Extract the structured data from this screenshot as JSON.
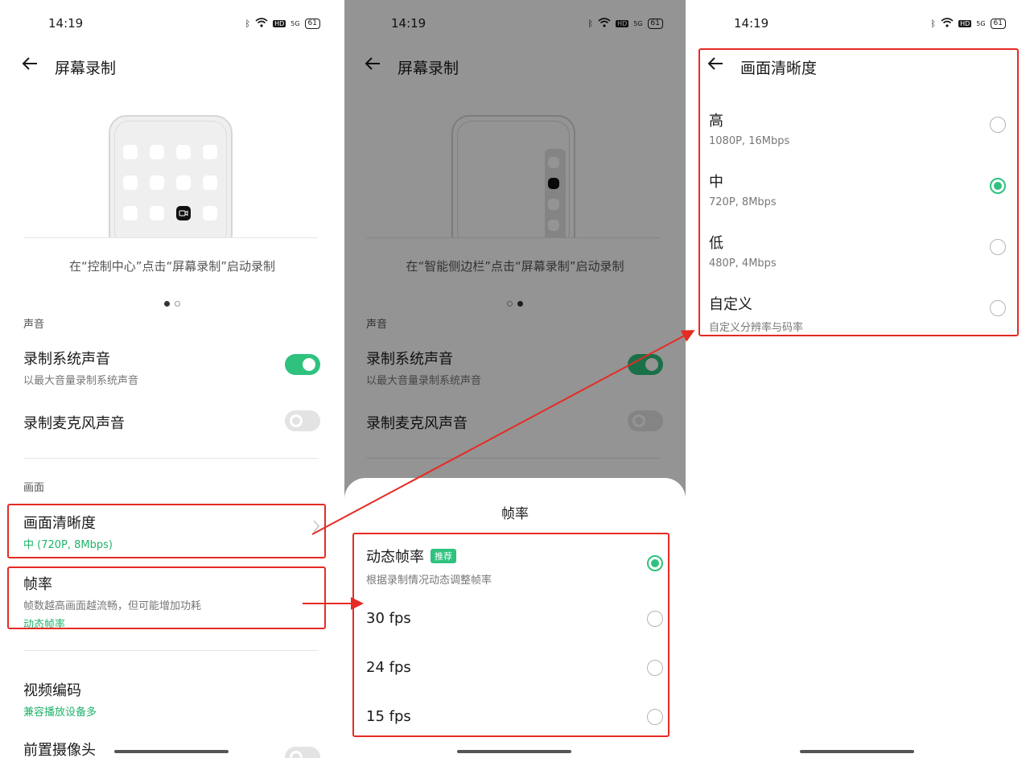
{
  "status": {
    "time": "14:19",
    "bluetooth": "ᛒ",
    "wifi": "wifi-icon",
    "hd": "HD",
    "signal": "5G",
    "battery": "61"
  },
  "screen1": {
    "title": "屏幕录制",
    "caption": "在“控制中心”点击“屏幕录制”启动录制",
    "sound_section": "声音",
    "sys_sound": {
      "title": "录制系统声音",
      "subtitle": "以最大音量录制系统声音",
      "enabled": true
    },
    "mic_sound": {
      "title": "录制麦克风声音",
      "enabled": false
    },
    "picture_section": "画面",
    "quality": {
      "title": "画面清晰度",
      "value": "中 (720P, 8Mbps)"
    },
    "framerate": {
      "title": "帧率",
      "subtitle": "帧数越高画面越流畅，但可能增加功耗",
      "value": "动态帧率"
    },
    "codec": {
      "title": "视频编码",
      "value": "兼容播放设备多"
    },
    "front_camera": {
      "title": "前置摄像头"
    }
  },
  "screen2": {
    "title": "屏幕录制",
    "caption": "在“智能侧边栏”点击“屏幕录制”启动录制",
    "sound_section": "声音",
    "sys_sound": {
      "title": "录制系统声音",
      "subtitle": "以最大音量录制系统声音"
    },
    "mic_sound": {
      "title": "录制麦克风声音"
    },
    "sheet_title": "帧率",
    "options": [
      {
        "title": "动态帧率",
        "badge": "推荐",
        "subtitle": "根据录制情况动态调整帧率",
        "selected": true
      },
      {
        "title": "30 fps",
        "selected": false
      },
      {
        "title": "24 fps",
        "selected": false
      },
      {
        "title": "15 fps",
        "selected": false
      }
    ]
  },
  "screen3": {
    "title": "画面清晰度",
    "options": [
      {
        "title": "高",
        "subtitle": "1080P, 16Mbps",
        "selected": false
      },
      {
        "title": "中",
        "subtitle": "720P, 8Mbps",
        "selected": true
      },
      {
        "title": "低",
        "subtitle": "480P, 4Mbps",
        "selected": false
      },
      {
        "title": "自定义",
        "subtitle": "自定义分辨率与码率",
        "selected": false
      }
    ]
  },
  "colors": {
    "accent": "#2ec27e",
    "highlight": "#e52b24"
  }
}
